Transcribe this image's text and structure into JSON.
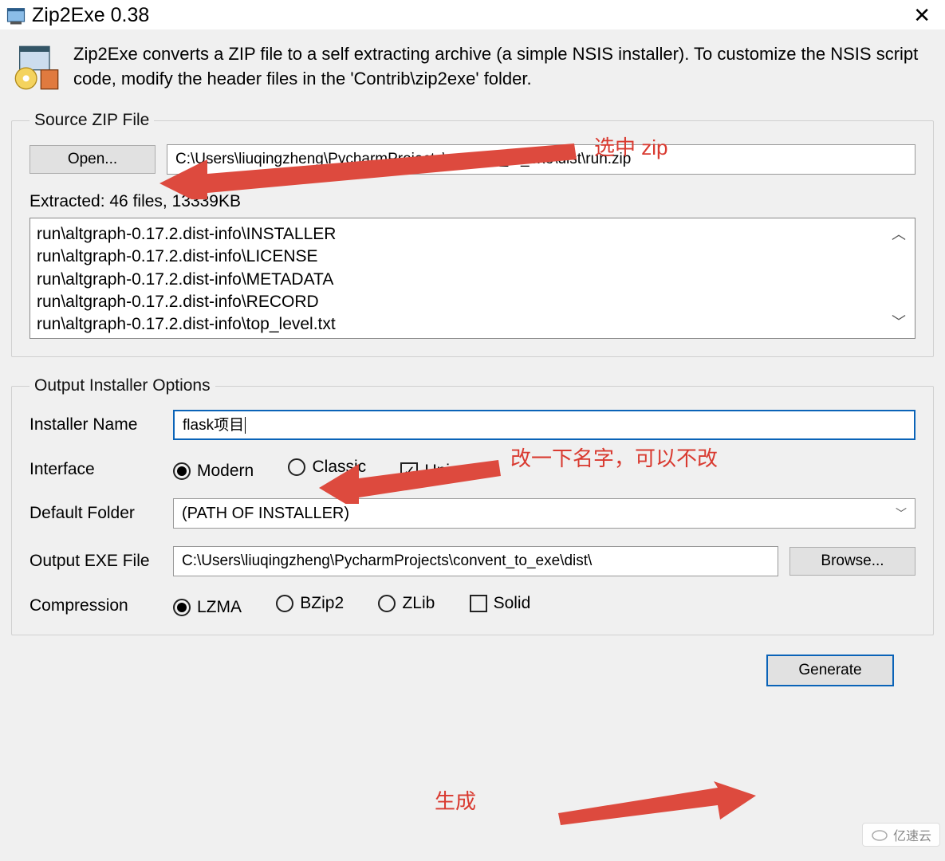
{
  "window": {
    "title": "Zip2Exe 0.38",
    "close": "✕"
  },
  "intro": {
    "text": "Zip2Exe converts a ZIP file to a self extracting archive (a simple NSIS installer). To customize the NSIS script code, modify the header files in the 'Contrib\\zip2exe' folder."
  },
  "source": {
    "legend": "Source ZIP File",
    "open_btn": "Open...",
    "zip_path": "C:\\Users\\liuqingzheng\\PycharmProjects\\convent_to_exe\\dist\\run.zip",
    "status": "Extracted: 46 files, 13339KB",
    "files": [
      "run\\altgraph-0.17.2.dist-info\\INSTALLER",
      "run\\altgraph-0.17.2.dist-info\\LICENSE",
      "run\\altgraph-0.17.2.dist-info\\METADATA",
      "run\\altgraph-0.17.2.dist-info\\RECORD",
      "run\\altgraph-0.17.2.dist-info\\top_level.txt"
    ]
  },
  "options": {
    "legend": "Output Installer Options",
    "labels": {
      "name": "Installer Name",
      "interface": "Interface",
      "default_folder": "Default Folder",
      "output_exe": "Output EXE File",
      "compression": "Compression"
    },
    "installer_name": "flask项目",
    "interface": {
      "modern": "Modern",
      "classic": "Classic",
      "unicode": "Unicode"
    },
    "default_folder_value": "(PATH OF INSTALLER)",
    "output_path": "C:\\Users\\liuqingzheng\\PycharmProjects\\convent_to_exe\\dist\\",
    "browse_btn": "Browse...",
    "compression": {
      "lzma": "LZMA",
      "bzip2": "BZip2",
      "zlib": "ZLib",
      "solid": "Solid"
    }
  },
  "generate_btn": "Generate",
  "annotations": {
    "select_zip": "选中 zip",
    "rename": "改一下名字，可以不改",
    "generate": "生成"
  },
  "watermark": "亿速云"
}
